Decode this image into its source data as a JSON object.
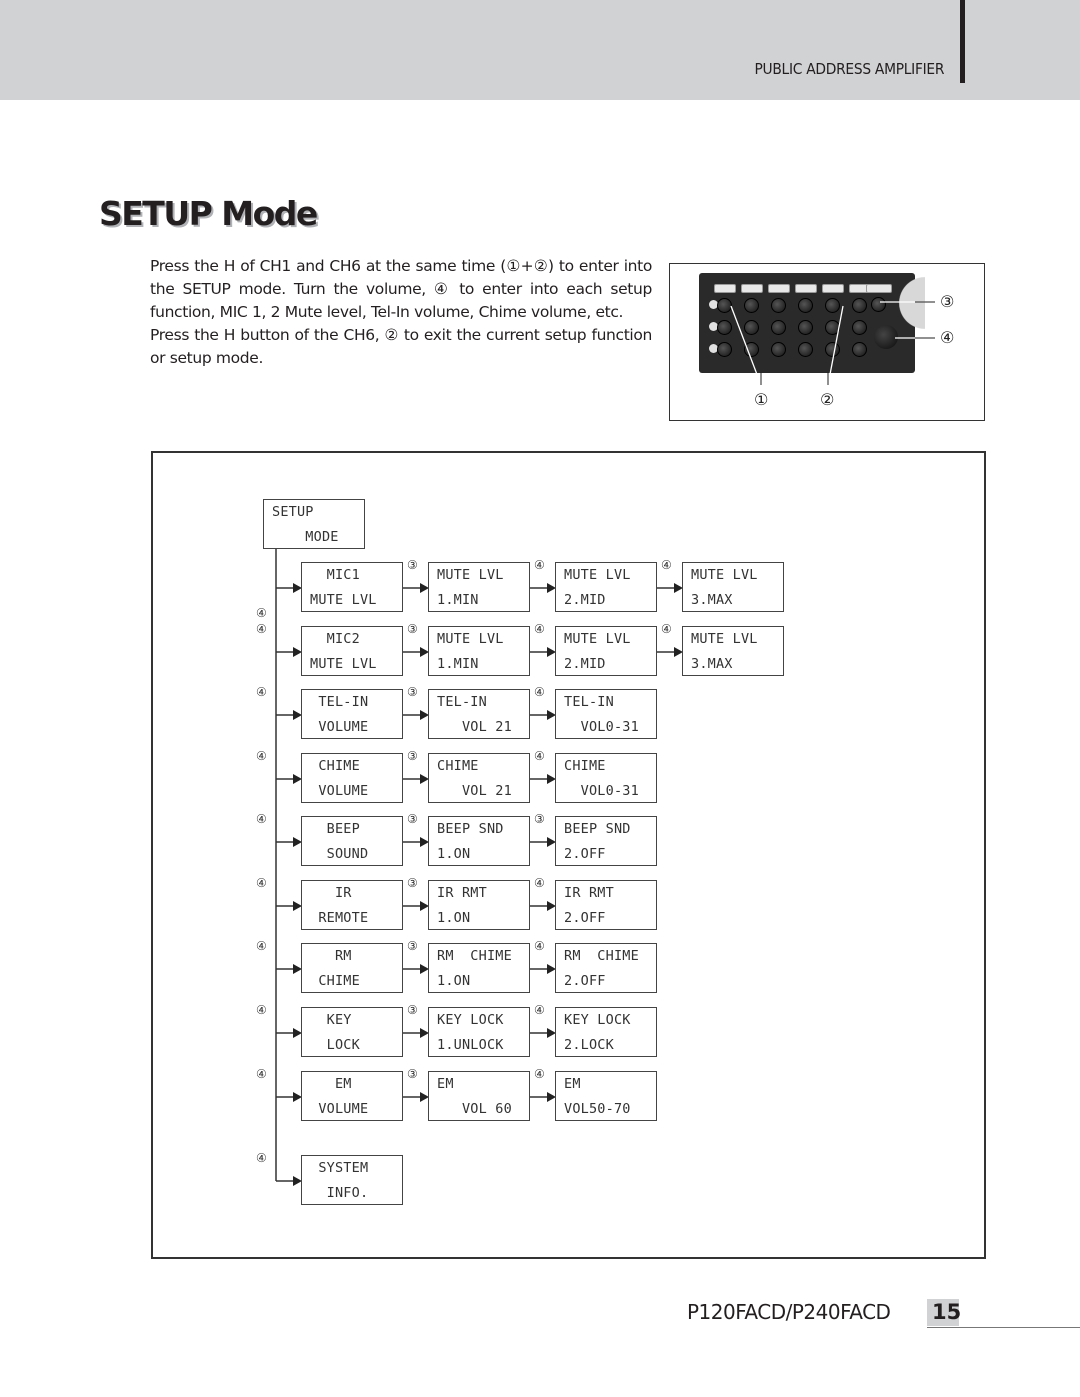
{
  "header": {
    "running_title": "PUBLIC ADDRESS AMPLIFIER"
  },
  "section": {
    "title": "SETUP Mode"
  },
  "intro": {
    "paragraphs": [
      "Press the H of CH1 and CH6 at the same time (①+②) to enter into the SETUP mode. Turn the volume, ④ to enter into each setup function, MIC 1, 2 Mute level, Tel-In volume, Chime volume, etc.",
      "Press the H button of the CH6, ② to exit the current setup function or setup mode."
    ]
  },
  "photo": {
    "description": "front panel control buttons",
    "callouts": {
      "c1": "①",
      "c2": "②",
      "c3": "③",
      "c4": "④"
    }
  },
  "diagram": {
    "root": {
      "line1": "SETUP",
      "line2": "    MODE"
    },
    "spine_step": "④",
    "rows": [
      {
        "nodes": [
          {
            "line1": "  MIC1",
            "line2": "MUTE LVL"
          },
          {
            "line1": "MUTE LVL",
            "line2": "1.MIN"
          },
          {
            "line1": "MUTE LVL",
            "line2": "2.MID"
          },
          {
            "line1": "MUTE LVL",
            "line2": "3.MAX"
          }
        ],
        "steps": [
          "③",
          "④",
          "④"
        ]
      },
      {
        "nodes": [
          {
            "line1": "  MIC2",
            "line2": "MUTE LVL"
          },
          {
            "line1": "MUTE LVL",
            "line2": "1.MIN"
          },
          {
            "line1": "MUTE LVL",
            "line2": "2.MID"
          },
          {
            "line1": "MUTE LVL",
            "line2": "3.MAX"
          }
        ],
        "steps": [
          "③",
          "④",
          "④"
        ]
      },
      {
        "nodes": [
          {
            "line1": " TEL-IN",
            "line2": " VOLUME"
          },
          {
            "line1": "TEL-IN",
            "line2": "   VOL 21"
          },
          {
            "line1": "TEL-IN",
            "line2": "  VOL0-31"
          }
        ],
        "steps": [
          "③",
          "④"
        ]
      },
      {
        "nodes": [
          {
            "line1": " CHIME",
            "line2": " VOLUME"
          },
          {
            "line1": "CHIME",
            "line2": "   VOL 21"
          },
          {
            "line1": "CHIME",
            "line2": "  VOL0-31"
          }
        ],
        "steps": [
          "③",
          "④"
        ]
      },
      {
        "nodes": [
          {
            "line1": "  BEEP",
            "line2": "  SOUND"
          },
          {
            "line1": "BEEP SND",
            "line2": "1.ON"
          },
          {
            "line1": "BEEP SND",
            "line2": "2.OFF"
          }
        ],
        "steps": [
          "③",
          "③"
        ]
      },
      {
        "nodes": [
          {
            "line1": "   IR",
            "line2": " REMOTE"
          },
          {
            "line1": "IR RMT",
            "line2": "1.ON"
          },
          {
            "line1": "IR RMT",
            "line2": "2.OFF"
          }
        ],
        "steps": [
          "③",
          "④"
        ]
      },
      {
        "nodes": [
          {
            "line1": "   RM",
            "line2": " CHIME"
          },
          {
            "line1": "RM  CHIME",
            "line2": "1.ON"
          },
          {
            "line1": "RM  CHIME",
            "line2": "2.OFF"
          }
        ],
        "steps": [
          "③",
          "④"
        ]
      },
      {
        "nodes": [
          {
            "line1": "  KEY",
            "line2": "  LOCK"
          },
          {
            "line1": "KEY LOCK",
            "line2": "1.UNLOCK"
          },
          {
            "line1": "KEY LOCK",
            "line2": "2.LOCK"
          }
        ],
        "steps": [
          "③",
          "④"
        ]
      },
      {
        "nodes": [
          {
            "line1": "   EM",
            "line2": " VOLUME"
          },
          {
            "line1": "EM",
            "line2": "   VOL 60"
          },
          {
            "line1": "EM",
            "line2": "VOL50-70"
          }
        ],
        "steps": [
          "③",
          "④"
        ]
      },
      {
        "nodes": [
          {
            "line1": " SYSTEM",
            "line2": "  INFO."
          }
        ],
        "steps": []
      }
    ]
  },
  "footer": {
    "model": "P120FACD/P240FACD",
    "page_number": "15"
  }
}
